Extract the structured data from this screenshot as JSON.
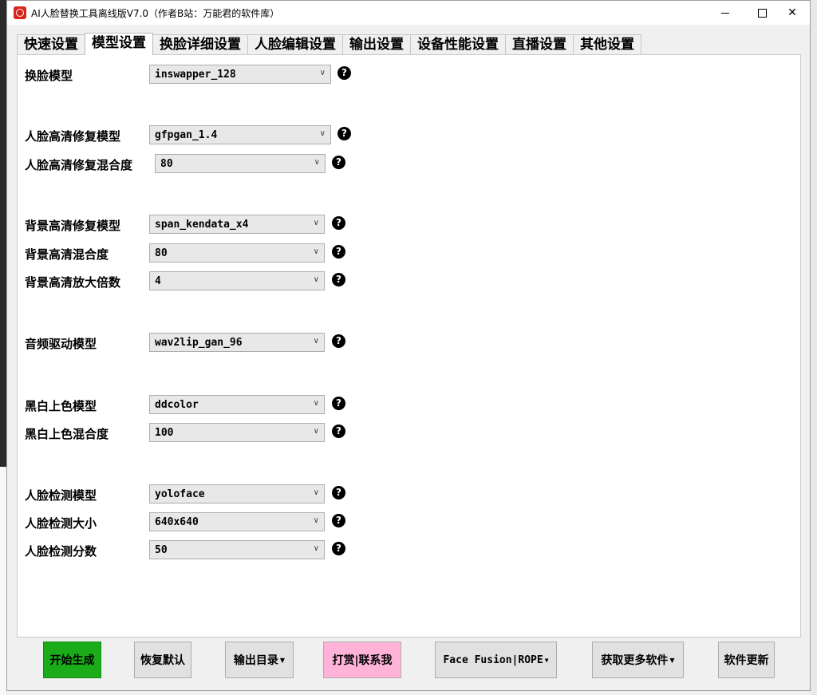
{
  "window": {
    "title": "AI人脸替换工具离线版V7.0（作者B站：万能君的软件库）"
  },
  "tabs": [
    {
      "label": "快速设置"
    },
    {
      "label": "模型设置",
      "active": true
    },
    {
      "label": "换脸详细设置"
    },
    {
      "label": "人脸编辑设置"
    },
    {
      "label": "输出设置"
    },
    {
      "label": "设备性能设置"
    },
    {
      "label": "直播设置"
    },
    {
      "label": "其他设置"
    }
  ],
  "fields": {
    "swap_model": {
      "label": "换脸模型",
      "value": "inswapper_128"
    },
    "face_enhance_model": {
      "label": "人脸高清修复模型",
      "value": "gfpgan_1.4"
    },
    "face_enhance_blend": {
      "label": "人脸高清修复混合度",
      "value": "80"
    },
    "bg_enhance_model": {
      "label": "背景高清修复模型",
      "value": "span_kendata_x4"
    },
    "bg_blend": {
      "label": "背景高清混合度",
      "value": "80"
    },
    "bg_scale": {
      "label": "背景高清放大倍数",
      "value": "4"
    },
    "audio_model": {
      "label": "音频驱动模型",
      "value": "wav2lip_gan_96"
    },
    "colorize_model": {
      "label": "黑白上色模型",
      "value": "ddcolor"
    },
    "colorize_blend": {
      "label": "黑白上色混合度",
      "value": "100"
    },
    "detect_model": {
      "label": "人脸检测模型",
      "value": "yoloface"
    },
    "detect_size": {
      "label": "人脸检测大小",
      "value": "640x640"
    },
    "detect_score": {
      "label": "人脸检测分数",
      "value": "50"
    }
  },
  "help_glyph": "?",
  "buttons": {
    "start": "开始生成",
    "reset": "恢复默认",
    "output_dir": "输出目录",
    "donate": "打赏|联系我",
    "facefusion": "Face Fusion|ROPE",
    "more_software": "获取更多软件",
    "update": "软件更新"
  },
  "colors": {
    "start_button": "#1aad19",
    "donate_button": "#ffb3d9",
    "app_icon": "#d9261c"
  }
}
